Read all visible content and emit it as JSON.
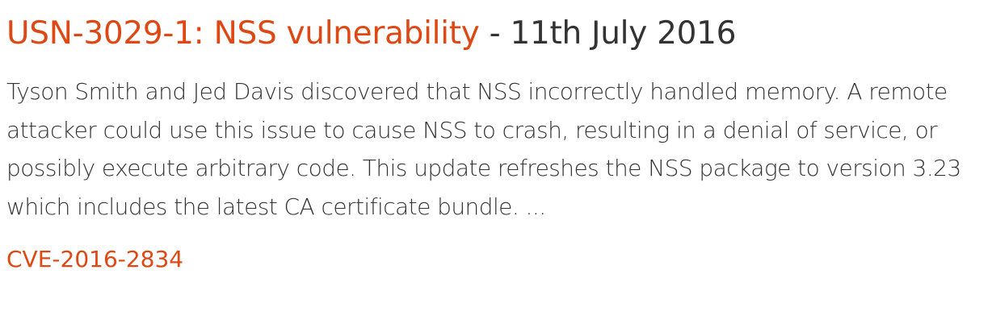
{
  "notice": {
    "title_link": "USN-3029-1: NSS vulnerability",
    "title_separator": " - ",
    "date": "11th July 2016",
    "summary": "Tyson Smith and Jed Davis discovered that NSS incorrectly handled memory. A remote attacker could use this issue to cause NSS to crash, resulting in a denial of service, or possibly execute arbitrary code. This update refreshes the NSS package to version 3.23 which includes the latest CA certificate bundle. ...",
    "cves": [
      "CVE-2016-2834"
    ]
  },
  "colors": {
    "link": "#dd4814",
    "text": "#333333",
    "background": "#ffffff"
  }
}
